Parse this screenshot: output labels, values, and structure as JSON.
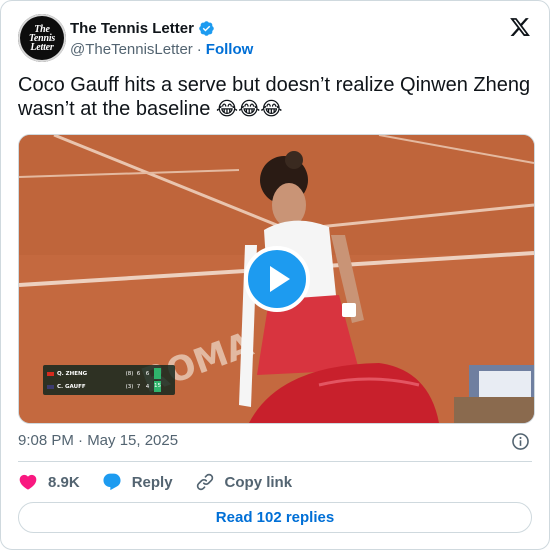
{
  "author": {
    "display_name": "The Tennis Letter",
    "handle": "@TheTennisLetter",
    "follow_label": "Follow",
    "avatar_logo": [
      "The",
      "Tennis",
      "Letter"
    ]
  },
  "tweet": {
    "text": "Coco Gauff hits a serve but doesn’t realize Qinwen Zheng wasn’t at the baseline",
    "emojis": "😂😂😂",
    "timestamp": "9:08 PM · May 15, 2025"
  },
  "media": {
    "type": "video",
    "scoreboard": {
      "rows": [
        {
          "name": "Q. ZHENG",
          "seed": "(8)",
          "sets": "6",
          "games": "6",
          "current": "",
          "flag_color": "#d52b1e"
        },
        {
          "name": "C. GAUFF",
          "seed": "(3)",
          "sets": "7",
          "games": "4",
          "current": "15",
          "flag_color": "#3c3b6e"
        }
      ]
    }
  },
  "actions": {
    "likes": "8.9K",
    "reply_label": "Reply",
    "copy_link_label": "Copy link",
    "read_replies_label": "Read 102 replies"
  },
  "colors": {
    "accent": "#1d9bf0",
    "link": "#006fd6",
    "like": "#f91880",
    "muted": "#536471"
  },
  "icons": {
    "verified": "verified-badge-icon",
    "brand": "x-logo-icon",
    "play": "play-icon",
    "info": "info-icon",
    "like": "heart-icon",
    "reply": "speech-bubble-icon",
    "copy_link": "link-icon"
  }
}
